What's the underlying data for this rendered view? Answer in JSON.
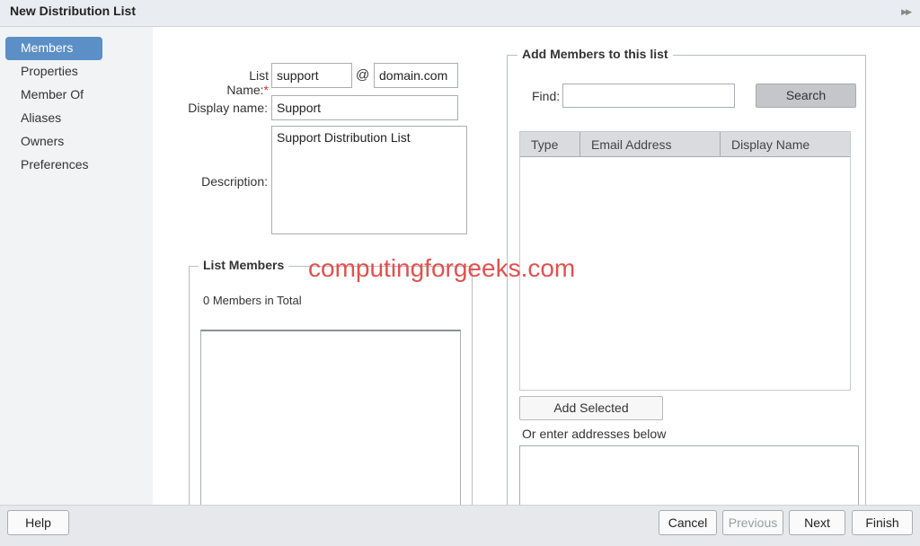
{
  "window": {
    "title": "New Distribution List",
    "collapse_icon": "double-chevron-right-icon"
  },
  "sidebar": {
    "items": [
      {
        "label": "Members",
        "active": true
      },
      {
        "label": "Properties",
        "active": false
      },
      {
        "label": "Member Of",
        "active": false
      },
      {
        "label": "Aliases",
        "active": false
      },
      {
        "label": "Owners",
        "active": false
      },
      {
        "label": "Preferences",
        "active": false
      }
    ]
  },
  "form": {
    "list_name_label": "List Name:",
    "required_mark": "*",
    "list_name_value": "support",
    "at_sign": "@",
    "domain_value": "domain.com",
    "display_name_label": "Display name:",
    "display_name_value": "Support",
    "description_label": "Description:",
    "description_value": "Support Distribution List"
  },
  "list_members": {
    "legend": "List Members",
    "count_text": "0 Members in Total"
  },
  "add_members": {
    "legend": "Add Members to this list",
    "find_label": "Find:",
    "find_value": "",
    "search_button": "Search",
    "columns": [
      "Type",
      "Email Address",
      "Display Name"
    ],
    "add_selected_button": "Add Selected",
    "enter_below_text": "Or enter addresses below",
    "addresses_value": ""
  },
  "footer": {
    "help": "Help",
    "cancel": "Cancel",
    "previous": "Previous",
    "next": "Next",
    "finish": "Finish"
  },
  "watermark": "computingforgeeks.com",
  "colors": {
    "accent": "#5b8fc5",
    "required": "#d0342c",
    "watermark": "#e0514f"
  }
}
